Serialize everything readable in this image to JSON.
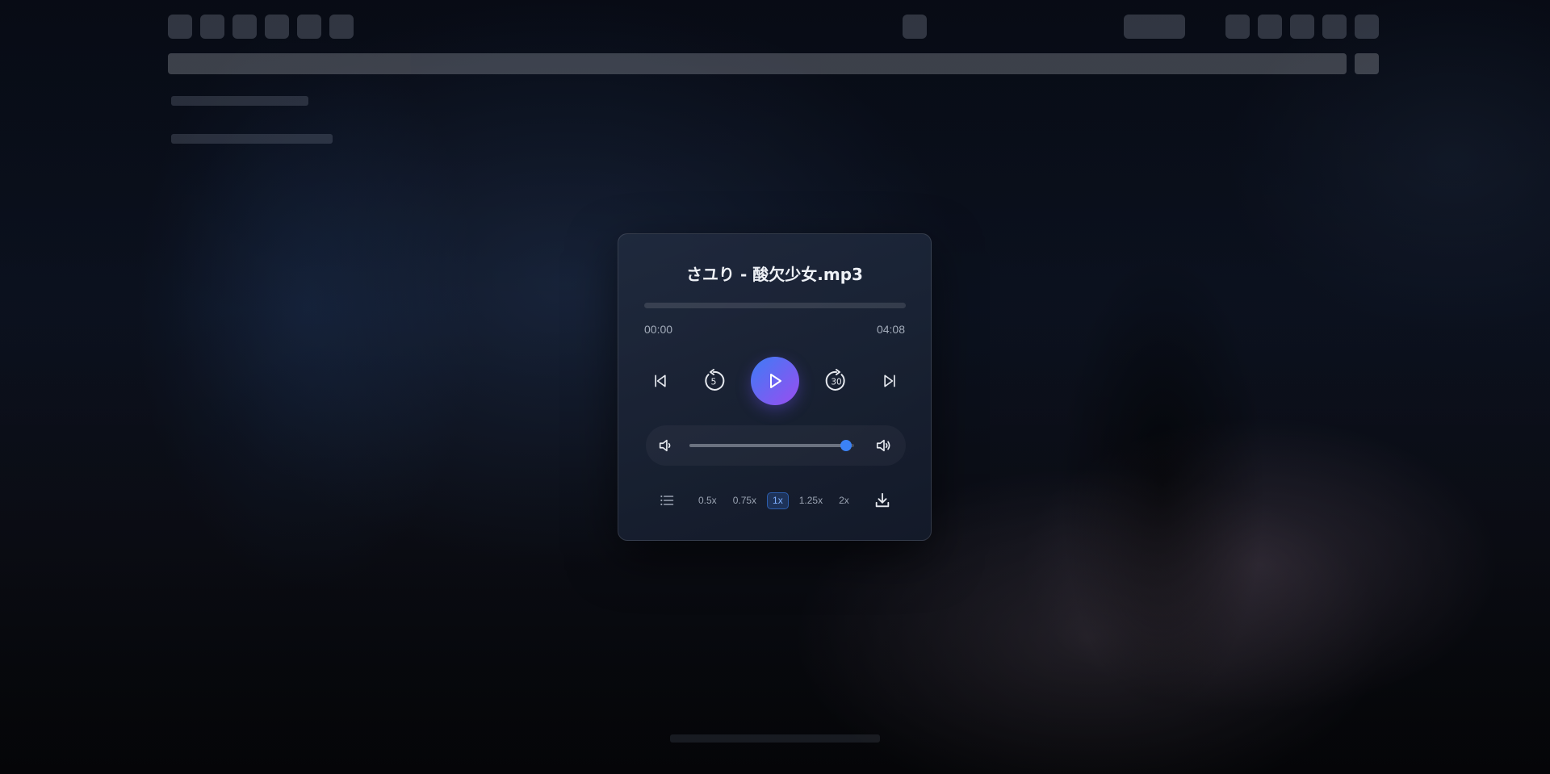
{
  "player": {
    "title": "さユり - 酸欠少女.mp3",
    "current_time": "00:00",
    "total_time": "04:08",
    "progress": 0,
    "volume": 0.95,
    "speeds": [
      "0.5x",
      "0.75x",
      "1x",
      "1.25x",
      "2x"
    ],
    "active_speed": "1x",
    "icons": {
      "previous": "skip-previous-icon",
      "rewind": "rewind-5-icon",
      "play": "play-icon",
      "forward": "forward-30-icon",
      "next": "skip-next-icon",
      "volume_low": "volume-low-icon",
      "volume_high": "volume-high-icon",
      "playlist": "playlist-icon",
      "download": "download-icon"
    },
    "rewind_seconds": "5",
    "forward_seconds": "30",
    "colors": {
      "accent": "#3b82f6",
      "play_gradient_start": "#3d7cf5",
      "play_gradient_end": "#9a4df0",
      "card_bg": "#1c2538",
      "text": "#eef1f6",
      "muted": "#a3acba"
    }
  }
}
